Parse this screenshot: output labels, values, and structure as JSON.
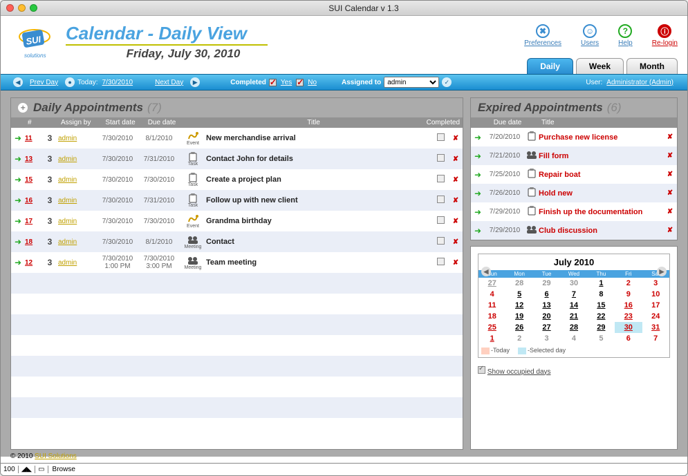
{
  "window": {
    "title": "SUI Calendar v 1.3"
  },
  "header": {
    "title": "Calendar - Daily View",
    "subtitle": "Friday, July 30, 2010",
    "links": {
      "preferences": "Preferences",
      "users": "Users",
      "help": "Help",
      "relogin": "Re-login"
    }
  },
  "tabs": {
    "daily": "Daily",
    "week": "Week",
    "month": "Month",
    "active": "daily"
  },
  "bluebar": {
    "prev": "Prev Day",
    "today_lbl": "Today:",
    "today": "7/30/2010",
    "next": "Next Day",
    "completed_lbl": "Completed",
    "yes": "Yes",
    "no": "No",
    "assigned_lbl": "Assigned to",
    "assigned_sel": "admin",
    "user_lbl": "User:",
    "user": "Administrator (Admin)"
  },
  "daily": {
    "title": "Daily Appointments",
    "count": "(7)",
    "cols": {
      "id": "#",
      "assign": "Assign by",
      "start": "Start date",
      "due": "Due date",
      "title": "Title",
      "comp": "Completed"
    },
    "rows": [
      {
        "id": "11",
        "pr": "3",
        "assign": "admin",
        "start": "7/30/2010",
        "due": "8/1/2010",
        "type": "Event",
        "title": "New merchandise arrival"
      },
      {
        "id": "13",
        "pr": "3",
        "assign": "admin",
        "start": "7/30/2010",
        "due": "7/31/2010",
        "type": "Task",
        "title": "Contact John for details"
      },
      {
        "id": "15",
        "pr": "3",
        "assign": "admin",
        "start": "7/30/2010",
        "due": "7/30/2010",
        "type": "Task",
        "title": "Create a project plan"
      },
      {
        "id": "16",
        "pr": "3",
        "assign": "admin",
        "start": "7/30/2010",
        "due": "7/31/2010",
        "type": "Task",
        "title": "Follow up with new client"
      },
      {
        "id": "17",
        "pr": "3",
        "assign": "admin",
        "start": "7/30/2010",
        "due": "7/30/2010",
        "type": "Event",
        "title": "Grandma birthday"
      },
      {
        "id": "18",
        "pr": "3",
        "assign": "admin",
        "start": "7/30/2010",
        "due": "8/1/2010",
        "type": "Meeting",
        "title": "Contact"
      },
      {
        "id": "12",
        "pr": "3",
        "assign": "admin",
        "start": "7/30/2010",
        "start2": "1:00 PM",
        "due": "7/30/2010",
        "due2": "3:00 PM",
        "type": "Meeting",
        "title": "Team meeting"
      }
    ]
  },
  "expired": {
    "title": "Expired Appointments",
    "count": "(6)",
    "cols": {
      "due": "Due date",
      "title": "Title"
    },
    "rows": [
      {
        "due": "7/20/2010",
        "type": "Task",
        "title": "Purchase new license"
      },
      {
        "due": "7/21/2010",
        "type": "Meeting",
        "title": "Fill form"
      },
      {
        "due": "7/25/2010",
        "type": "Task",
        "title": "Repair boat"
      },
      {
        "due": "7/26/2010",
        "type": "Task",
        "title": "Hold new"
      },
      {
        "due": "7/29/2010",
        "type": "Task",
        "title": "Finish up the documentation"
      },
      {
        "due": "7/29/2010",
        "type": "Meeting",
        "title": "Club discussion"
      }
    ]
  },
  "minical": {
    "title": "July  2010",
    "dow": [
      "Sun",
      "Mon",
      "Tue",
      "Wed",
      "Thu",
      "Fri",
      "Sat"
    ],
    "cells": [
      {
        "d": "27",
        "other": true,
        "occ": true
      },
      {
        "d": "28",
        "other": true
      },
      {
        "d": "29",
        "other": true
      },
      {
        "d": "30",
        "other": true
      },
      {
        "d": "1",
        "occ": true
      },
      {
        "d": "2",
        "wk": true
      },
      {
        "d": "3",
        "wk": true
      },
      {
        "d": "4",
        "wk": true
      },
      {
        "d": "5",
        "occ": true
      },
      {
        "d": "6",
        "occ": true
      },
      {
        "d": "7",
        "occ": true
      },
      {
        "d": "8"
      },
      {
        "d": "9",
        "wk": true
      },
      {
        "d": "10",
        "wk": true
      },
      {
        "d": "11",
        "wk": true
      },
      {
        "d": "12",
        "occ": true
      },
      {
        "d": "13",
        "occ": true
      },
      {
        "d": "14",
        "occ": true
      },
      {
        "d": "15",
        "occ": true
      },
      {
        "d": "16",
        "wk": true,
        "occ": true
      },
      {
        "d": "17",
        "wk": true
      },
      {
        "d": "18",
        "wk": true
      },
      {
        "d": "19",
        "occ": true
      },
      {
        "d": "20",
        "occ": true
      },
      {
        "d": "21",
        "occ": true
      },
      {
        "d": "22",
        "occ": true
      },
      {
        "d": "23",
        "wk": true,
        "occ": true
      },
      {
        "d": "24",
        "wk": true
      },
      {
        "d": "25",
        "wk": true,
        "occ": true
      },
      {
        "d": "26",
        "occ": true
      },
      {
        "d": "27",
        "occ": true
      },
      {
        "d": "28",
        "occ": true
      },
      {
        "d": "29",
        "occ": true
      },
      {
        "d": "30",
        "wk": true,
        "occ": true,
        "sel": true,
        "today": true
      },
      {
        "d": "31",
        "wk": true,
        "occ": true
      },
      {
        "d": "1",
        "other": true,
        "occ": true,
        "wk": true
      },
      {
        "d": "2",
        "other": true
      },
      {
        "d": "3",
        "other": true
      },
      {
        "d": "4",
        "other": true
      },
      {
        "d": "5",
        "other": true
      },
      {
        "d": "6",
        "other": true,
        "wk": true
      },
      {
        "d": "7",
        "other": true,
        "wk": true
      }
    ],
    "legend_today": "-Today",
    "legend_sel": "-Selected day",
    "show_occ": "Show occupied days"
  },
  "footer": {
    "copy": "© 2010 ",
    "link": "SUI Solutions"
  },
  "status": {
    "zoom": "100",
    "mode": "Browse"
  }
}
